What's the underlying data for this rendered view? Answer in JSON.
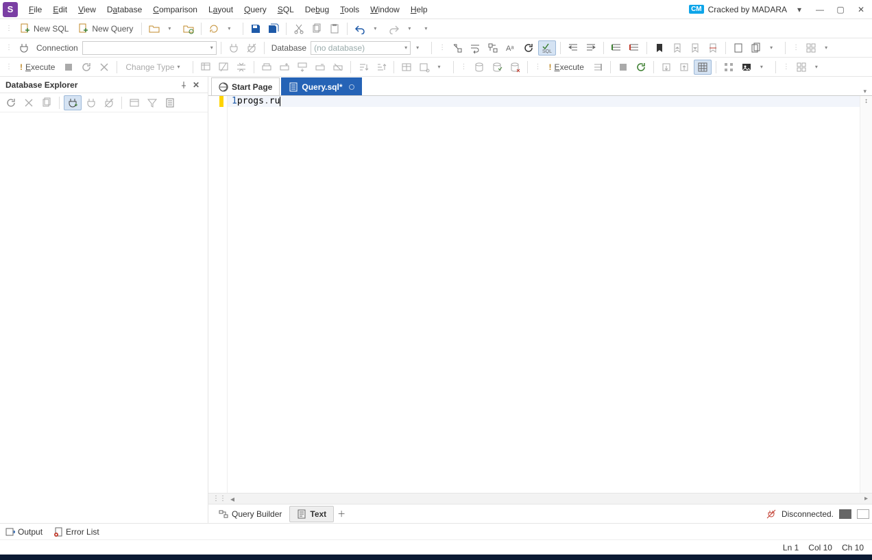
{
  "menubar": {
    "items": [
      "File",
      "Edit",
      "View",
      "Database",
      "Comparison",
      "Layout",
      "Query",
      "SQL",
      "Debug",
      "Tools",
      "Window",
      "Help"
    ],
    "title_badge": "CM",
    "title": "Cracked by MADARA"
  },
  "toolbar1": {
    "new_sql": "New SQL",
    "new_query": "New Query"
  },
  "toolbar2": {
    "connection_label": "Connection",
    "database_label": "Database",
    "database_value": "(no database)"
  },
  "toolbar3": {
    "execute": "Execute",
    "change_type": "Change Type",
    "execute2": "Execute"
  },
  "explorer": {
    "title": "Database Explorer"
  },
  "tabs": {
    "start": "Start Page",
    "query": "Query.sql*"
  },
  "editor": {
    "line1_num": "1",
    "line1_a": "progs",
    "line1_dot": ".",
    "line1_b": "ru"
  },
  "bottom_tabs": {
    "query_builder": "Query Builder",
    "text": "Text"
  },
  "status_right": {
    "disconnected": "Disconnected."
  },
  "bottom_bar": {
    "output": "Output",
    "error_list": "Error List"
  },
  "status": {
    "ln": "Ln 1",
    "col": "Col 10",
    "ch": "Ch 10"
  }
}
